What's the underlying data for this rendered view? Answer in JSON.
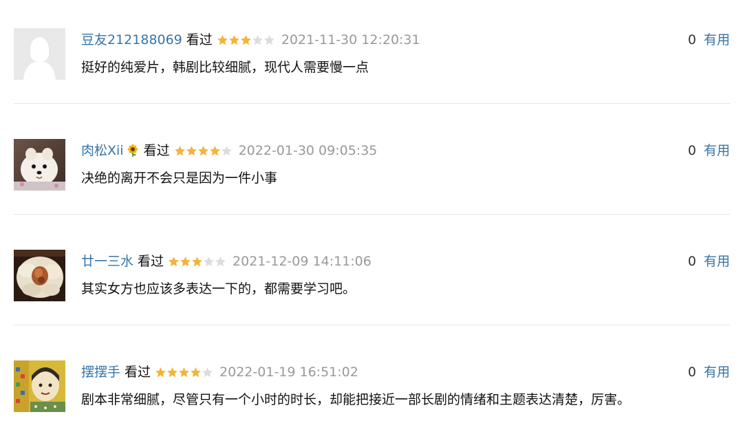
{
  "colors": {
    "link": "#3774a6",
    "meta": "#999999",
    "star_filled": "#f5b33a",
    "star_empty": "#dddddd",
    "divider": "#e5e5e5"
  },
  "comments": [
    {
      "username": "豆友212188069",
      "badge": "",
      "status": "看过",
      "rating": 3,
      "max_rating": 5,
      "timestamp": "2021-11-30 12:20:31",
      "text": "挺好的纯爱片，韩剧比较细腻，现代人需要慢一点",
      "votes": "0",
      "vote_label": "有用",
      "avatar": "default-avatar-icon"
    },
    {
      "username": "肉松Xii",
      "badge": "sunflower-icon",
      "status": "看过",
      "rating": 4,
      "max_rating": 5,
      "timestamp": "2022-01-30 09:05:35",
      "text": "决绝的离开不会只是因为一件小事",
      "votes": "0",
      "vote_label": "有用",
      "avatar": "pomeranian-dog-avatar"
    },
    {
      "username": "廿一三水",
      "badge": "",
      "status": "看过",
      "rating": 3,
      "max_rating": 5,
      "timestamp": "2021-12-09 14:11:06",
      "text": "其实女方也应该多表达一下的，都需要学习吧。",
      "votes": "0",
      "vote_label": "有用",
      "avatar": "flower-photo-avatar"
    },
    {
      "username": "摆摆手",
      "badge": "",
      "status": "看过",
      "rating": 4,
      "max_rating": 5,
      "timestamp": "2022-01-19 16:51:02",
      "text": "剧本非常细腻，尽管只有一个小时的时长，却能把接近一部长剧的情绪和主题表达清楚，厉害。",
      "votes": "0",
      "vote_label": "有用",
      "avatar": "cartoon-illustration-avatar"
    }
  ]
}
